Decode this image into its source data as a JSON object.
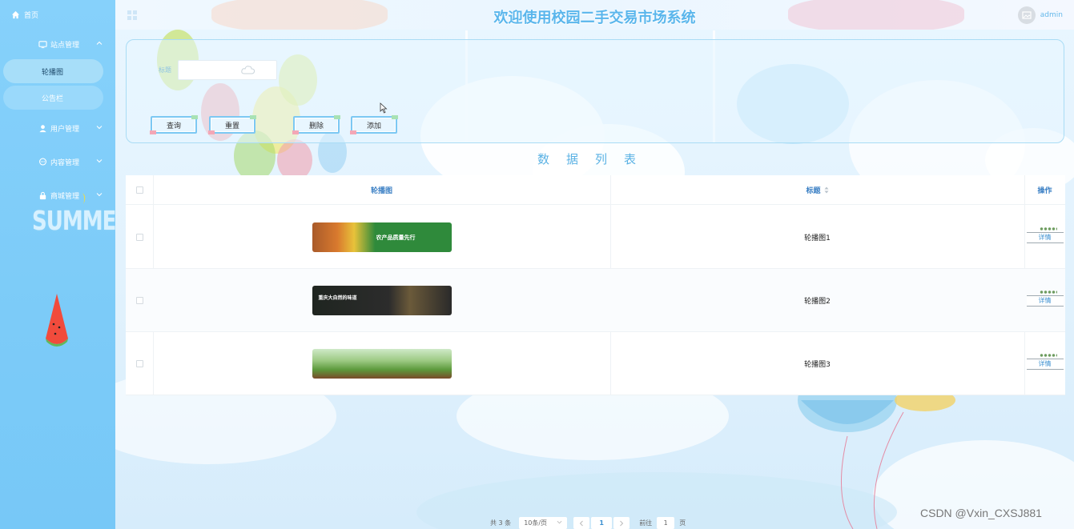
{
  "header": {
    "title": "欢迎使用校园二手交易市场系统",
    "username": "admin"
  },
  "sidebar": {
    "home": "首页",
    "groups": [
      {
        "label": "站点管理",
        "children": [
          "轮播图",
          "公告栏"
        ],
        "expanded": true,
        "active_child": "轮播图"
      },
      {
        "label": "用户管理",
        "expanded": false
      },
      {
        "label": "内容管理",
        "expanded": false
      },
      {
        "label": "商城管理",
        "expanded": false
      }
    ],
    "decor_text": "SUMMER"
  },
  "search": {
    "field_label": "标题",
    "field_value": "",
    "buttons": {
      "query": "查询",
      "reset": "重置",
      "delete": "删除",
      "add": "添加"
    }
  },
  "list_title": "数据列表",
  "table": {
    "columns": [
      "轮播图",
      "标题",
      "操作"
    ],
    "rows": [
      {
        "title": "轮播图1",
        "action": "详情",
        "banner_text": "农产品质量先行",
        "banner_color": "#2f8a3b"
      },
      {
        "title": "轮播图2",
        "action": "详情",
        "banner_text": "重庆大自然的味道",
        "banner_color": "#2a2a2a"
      },
      {
        "title": "轮播图3",
        "action": "详情",
        "banner_text": "",
        "banner_color": "#6fae4a"
      }
    ]
  },
  "pagination": {
    "total_text": "共 3 条",
    "page_size": "10条/页",
    "current_page": "1",
    "goto_label": "前往",
    "goto_value": "1",
    "page_unit": "页"
  },
  "watermark": "CSDN @Vxin_CXSJ881",
  "colors": {
    "accent": "#5ab6ec",
    "sidebar": "#86d1fb",
    "header_link": "#3a7fc4"
  }
}
